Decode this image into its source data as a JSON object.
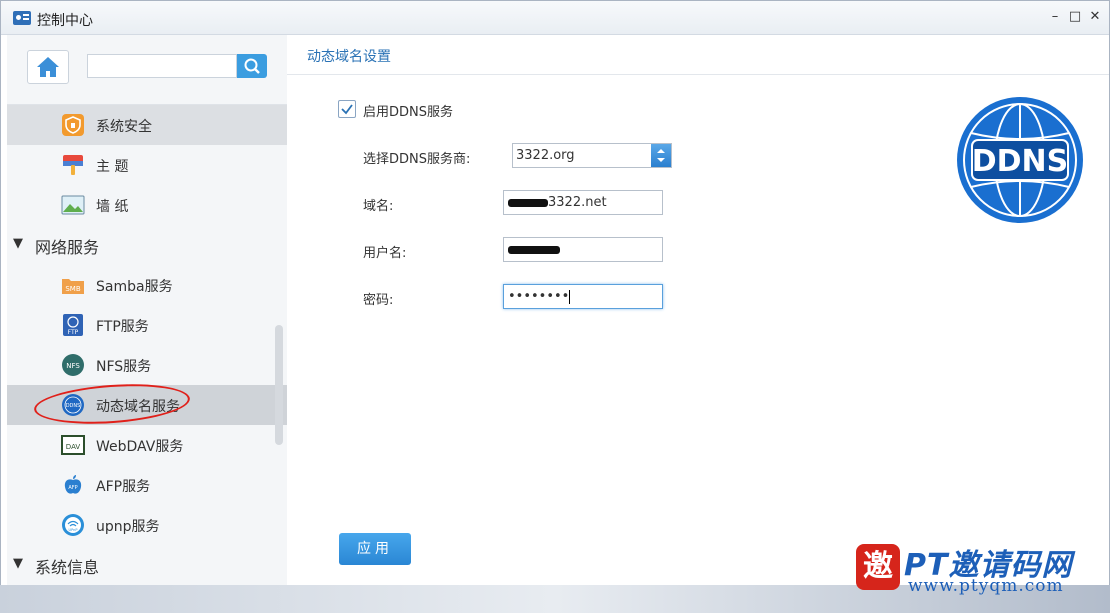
{
  "window": {
    "title": "控制中心",
    "minimize": "–",
    "maximize": "□",
    "close": "✕"
  },
  "sidebar": {
    "search_value": "",
    "items": [
      {
        "label": "系统安全",
        "icon": "shield-icon",
        "color": "#f29a2e"
      },
      {
        "label": "主 题",
        "icon": "theme-icon",
        "color": "#e8493c"
      },
      {
        "label": "墙 纸",
        "icon": "wallpaper-icon",
        "color": "#5fae4e"
      }
    ],
    "groups": [
      {
        "label": "网络服务",
        "items": [
          {
            "label": "Samba服务",
            "icon": "samba-icon",
            "badge": "SMB"
          },
          {
            "label": "FTP服务",
            "icon": "ftp-icon",
            "badge": "FTP"
          },
          {
            "label": "NFS服务",
            "icon": "nfs-icon",
            "badge": "NFS"
          },
          {
            "label": "动态域名服务",
            "icon": "ddns-icon",
            "badge": "DDNS"
          },
          {
            "label": "WebDAV服务",
            "icon": "webdav-icon",
            "badge": "DAV"
          },
          {
            "label": "AFP服务",
            "icon": "afp-icon",
            "badge": "AFP"
          },
          {
            "label": "upnp服务",
            "icon": "upnp-icon",
            "badge": "UPnP"
          }
        ]
      },
      {
        "label": "系统信息"
      }
    ]
  },
  "content": {
    "title": "动态域名设置",
    "enable_label": "启用DDNS服务",
    "enabled": true,
    "provider_label": "选择DDNS服务商:",
    "provider_value": "3322.org",
    "domain_label": "域名:",
    "domain_value_suffix": "3322.net",
    "username_label": "用户名:",
    "password_label": "密码:",
    "password_value": "••••••••",
    "apply_label": "应用",
    "logo_text": "DDNS"
  },
  "watermark": {
    "title": "PT邀请码网",
    "url": "www.ptyqm.com",
    "seal": "邀"
  },
  "colors": {
    "accent": "#2a86d4",
    "title_blue": "#2a72b5",
    "highlight_red": "#e0201a"
  }
}
